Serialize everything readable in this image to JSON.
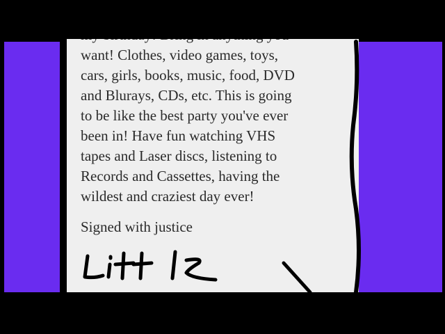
{
  "letter": {
    "body_lines": [
      "my birthday! Bring in anything you",
      "want! Clothes, video games, toys,",
      "cars, girls, books, music, food, DVD",
      "and Blurays, CDs, etc. This is going",
      "to be like the best party you've ever",
      "been in! Have fun watching VHS",
      "tapes and Laser discs, listening to",
      "Records and Cassettes, having the",
      "wildest and craziest day ever!"
    ],
    "signoff": "Signed with justice",
    "signature": "Litt le"
  },
  "colors": {
    "background": "#000000",
    "side_panels": "#6a2cf0",
    "paper": "#efefef",
    "text": "#2a2a2a"
  }
}
